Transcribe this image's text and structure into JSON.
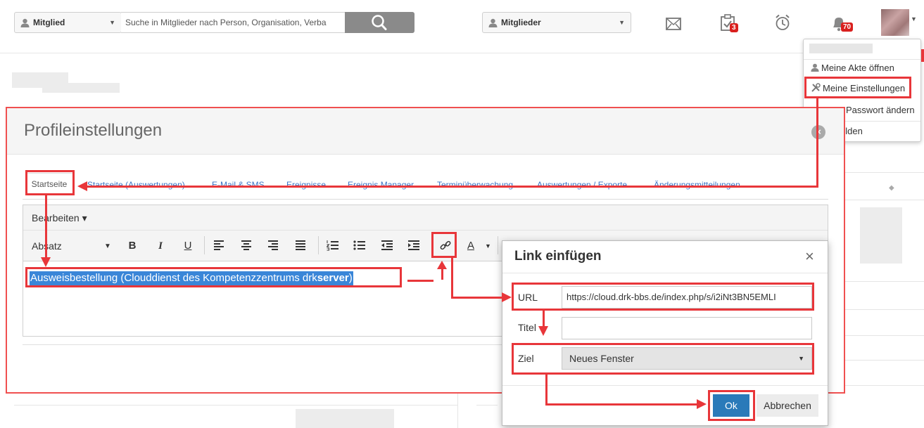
{
  "topbar": {
    "scope_select": "Mitglied",
    "search_placeholder": "Suche in Mitglieder nach Person, Organisation, Verba",
    "members_select": "Mitglieder",
    "tasks_badge": "3",
    "notifications_badge": "70"
  },
  "user_menu": {
    "items": [
      "Meine Akte öffnen",
      "Meine Einstellungen",
      "Passwort ändern",
      "elden"
    ]
  },
  "modal": {
    "title": "Profileinstellungen",
    "close": "×",
    "tabs": [
      "Startseite",
      "Startseite (Auswertungen)",
      "E-Mail & SMS",
      "Ereignisse",
      "Ereignis Manager",
      "Terminüberwachung",
      "Auswertungen / Exporte",
      "Änderungsmitteilungen"
    ]
  },
  "editor": {
    "menu_edit": "Bearbeiten ▾",
    "format_select": "Absatz",
    "content_text": "Ausweisbestellung (Clouddienst des Kompetenzzentrums drk",
    "content_bold": "server"
  },
  "link_dialog": {
    "title": "Link einfügen",
    "close": "×",
    "url_label": "URL",
    "url_value": "https://cloud.drk-bbs.de/index.php/s/i2iNt3BN5EMLI",
    "title_label": "Titel",
    "title_value": "",
    "target_label": "Ziel",
    "target_value": "Neues Fenster",
    "ok_label": "Ok",
    "cancel_label": "Abbrechen"
  },
  "colors": {
    "annotation": "#e8363a",
    "primary_button": "#2a7ab9",
    "selection": "#3a86d8",
    "link": "#3b73c4"
  }
}
